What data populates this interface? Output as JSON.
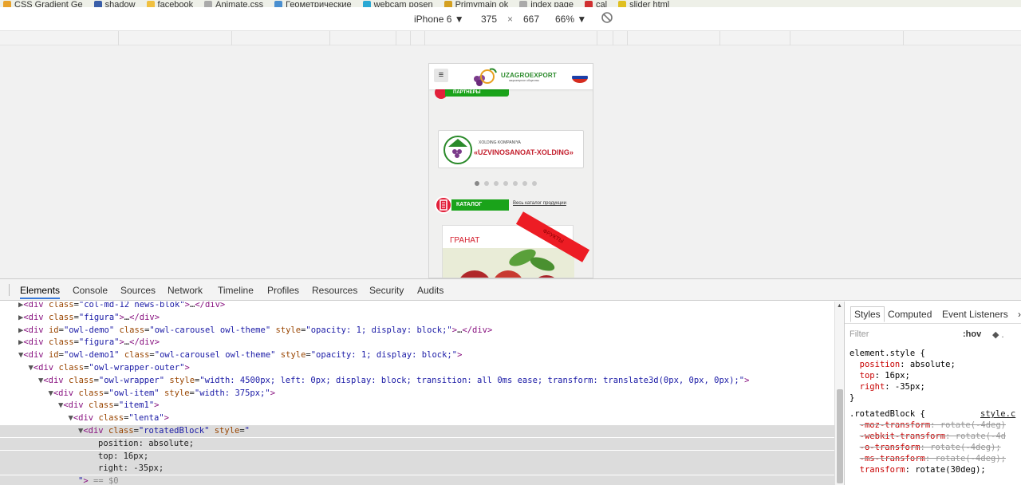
{
  "bookmarks": [
    {
      "label": "CSS Gradient Ge",
      "color": "#e8a22a"
    },
    {
      "label": "shadow",
      "color": "#3a5ea8"
    },
    {
      "label": "facebook",
      "color": "#f0c040"
    },
    {
      "label": "Animate.css",
      "color": "#aaaaaa"
    },
    {
      "label": "Геометрические",
      "color": "#4a8fd0"
    },
    {
      "label": "webcam posen",
      "color": "#2aa8d4"
    },
    {
      "label": "Primymain ok",
      "color": "#d4a020"
    },
    {
      "label": "index page",
      "color": "#aaaaaa"
    },
    {
      "label": "cal",
      "color": "#d03030"
    },
    {
      "label": "slider html",
      "color": "#e0c020"
    }
  ],
  "device_toolbar": {
    "device": "iPhone 6 ▼",
    "width": "375",
    "times": "×",
    "height": "667",
    "zoom": "66% ▼",
    "rotate_icon": "⃠"
  },
  "phone": {
    "burger": "≡",
    "logo_text": "UZAGROEXPORT",
    "logo_sub": "акционерное общество",
    "partners_label": "ПАРТНЕРЫ",
    "card_small": "XOLDING KOMPANIYA",
    "card_big": "«UZVINOSANOAT-XOLDING»",
    "catalog_label": "КАТАЛОГ",
    "catalog_link": "Весь каталог продукции",
    "product_name": "ГРАНАТ",
    "ribbon": "ФРУКТЫ",
    "carousel_dots": 7,
    "carousel_active": 0
  },
  "devtools": {
    "tabs": [
      "Elements",
      "Console",
      "Sources",
      "Network",
      "Timeline",
      "Profiles",
      "Resources",
      "Security",
      "Audits"
    ],
    "active_tab": "Elements",
    "dom_lines": [
      {
        "indent": 2,
        "arrow": "▶",
        "html": "<div class=\"col-md-12 news-blok\">…</div>",
        "hl": false
      },
      {
        "indent": 2,
        "arrow": "▶",
        "html": "<div class=\"figura\">…</div>",
        "hl": false
      },
      {
        "indent": 2,
        "arrow": "▶",
        "html": "<div id=\"owl-demo\" class=\"owl-carousel owl-theme\" style=\"opacity: 1; display: block;\">…</div>",
        "hl": false
      },
      {
        "indent": 2,
        "arrow": "▶",
        "html": "<div class=\"figura\">…</div>",
        "hl": false
      },
      {
        "indent": 2,
        "arrow": "▼",
        "html": "<div id=\"owl-demo1\" class=\"owl-carousel owl-theme\" style=\"opacity: 1; display: block;\">",
        "hl": false
      },
      {
        "indent": 3,
        "arrow": "▼",
        "html": "<div class=\"owl-wrapper-outer\">",
        "hl": false
      },
      {
        "indent": 4,
        "arrow": "▼",
        "html": "<div class=\"owl-wrapper\" style=\"width: 4500px; left: 0px; display: block; transition: all 0ms ease; transform: translate3d(0px, 0px, 0px);\">",
        "hl": false
      },
      {
        "indent": 5,
        "arrow": "▼",
        "html": "<div class=\"owl-item\" style=\"width: 375px;\">",
        "hl": false
      },
      {
        "indent": 6,
        "arrow": "▼",
        "html": "<div class=\"item1\">",
        "hl": false
      },
      {
        "indent": 7,
        "arrow": "▼",
        "html": "<div class=\"lenta\">",
        "hl": false
      },
      {
        "indent": 8,
        "arrow": "▼",
        "html": "<div class=\"rotatedBlock\" style=\"",
        "hl": true
      },
      {
        "indent": 10,
        "arrow": "",
        "html": "position: absolute;",
        "hl": true
      },
      {
        "indent": 10,
        "arrow": "",
        "html": "top: 16px;",
        "hl": true
      },
      {
        "indent": 10,
        "arrow": "",
        "html": "right: -35px;",
        "hl": true
      },
      {
        "indent": 8,
        "arrow": "",
        "html": "\"> == $0",
        "hl": true
      }
    ],
    "styles_tabs": [
      "Styles",
      "Computed",
      "Event Listeners",
      "›"
    ],
    "styles_active": "Styles",
    "filter_placeholder": "Filter",
    "hov": ":hov",
    "element_style_selector": "element.style {",
    "element_style_props": [
      {
        "prop": "position",
        "value": "absolute;"
      },
      {
        "prop": "top",
        "value": "16px;"
      },
      {
        "prop": "right",
        "value": "-35px;"
      }
    ],
    "rule_selector": ".rotatedBlock {",
    "rule_source": "style.c",
    "rule_props": [
      {
        "text": "-moz-transform: rotate(-4deg)",
        "struck": true
      },
      {
        "text": "-webkit-transform: rotate(-4d",
        "struck": true
      },
      {
        "text": "-o-transform: rotate(-4deg);",
        "struck": true
      },
      {
        "text": "-ms-transform: rotate(-4deg);",
        "struck": true
      },
      {
        "text": "transform: rotate(30deg);",
        "struck": false
      }
    ],
    "close_brace": "}"
  }
}
